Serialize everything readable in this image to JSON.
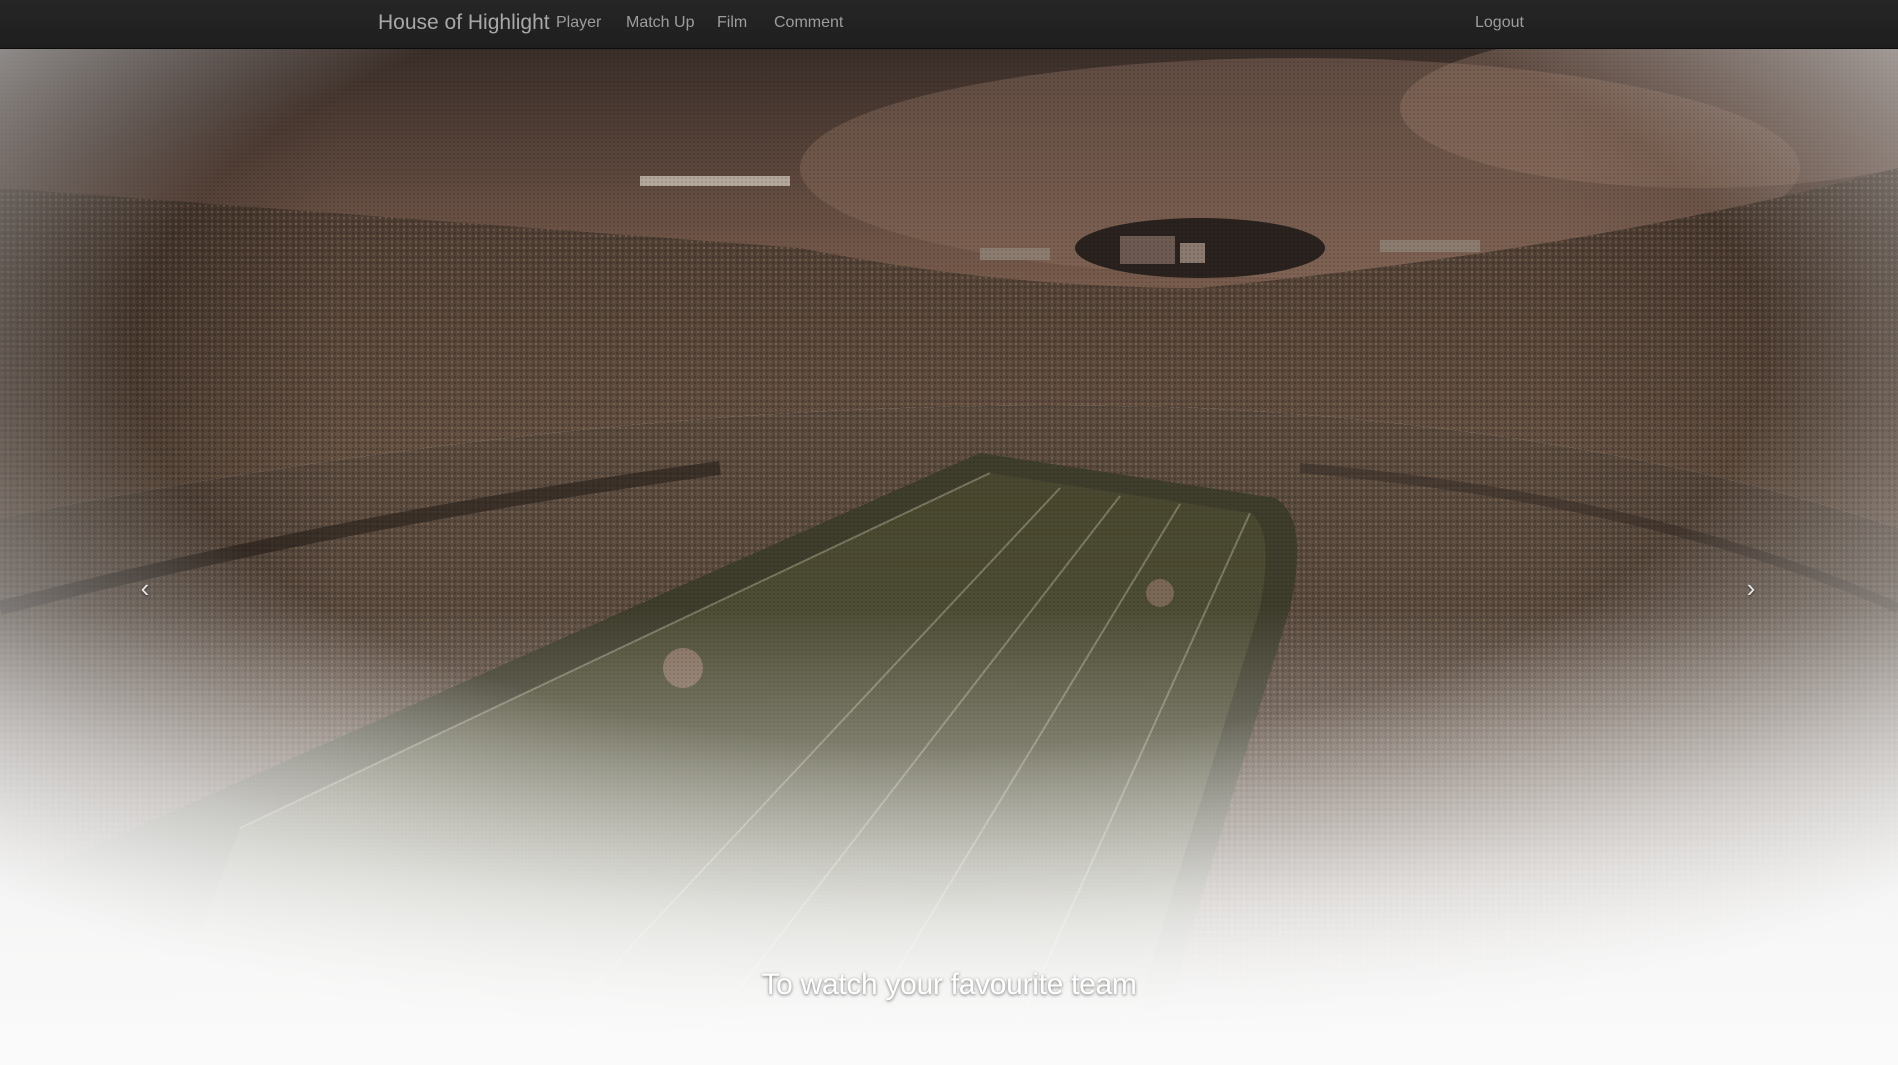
{
  "navbar": {
    "brand": "House of Highlight",
    "items": [
      {
        "label": "Player"
      },
      {
        "label": "Match Up"
      },
      {
        "label": "Film"
      },
      {
        "label": "Comment"
      }
    ],
    "logout_label": "Logout"
  },
  "carousel": {
    "caption": "To watch your favourite team",
    "prev_icon": "‹",
    "next_icon": "›",
    "slide_count": 3,
    "active_slide": 1,
    "image": "football stadium aerial view"
  },
  "colors": {
    "navbar_bg": "#222222",
    "nav_text": "#9d9d9d",
    "brand_text": "#a8a8a8",
    "caption_text": "#ffffff"
  }
}
